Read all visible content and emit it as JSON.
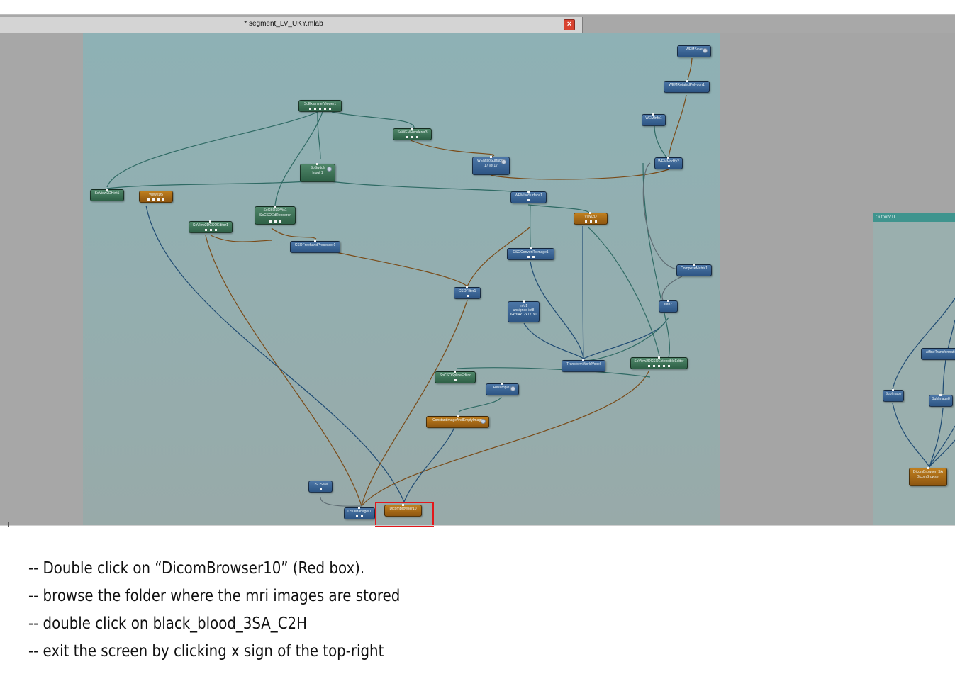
{
  "tab": {
    "title": "* segment_LV_UKY.mlab",
    "close_symbol": "×"
  },
  "network": {
    "nodes": [
      {
        "id": "n1",
        "label": "WEMSave",
        "color": "blue"
      },
      {
        "id": "n2",
        "label": "WEMRotatedPolygon1",
        "color": "blue"
      },
      {
        "id": "n3",
        "label": "WEMInfo1",
        "color": "blue"
      },
      {
        "id": "n4",
        "label": "SoExaminerViewer1",
        "color": "green"
      },
      {
        "id": "n5",
        "label": "SoWEMRenderer3",
        "color": "green"
      },
      {
        "id": "n6",
        "label": "WEMIsoSurface1\n17 @ 17",
        "color": "blue"
      },
      {
        "id": "n7",
        "label": "WEMModify2",
        "color": "blue"
      },
      {
        "id": "n8",
        "label": "SoSwitch\nInput 1",
        "color": "green"
      },
      {
        "id": "n9",
        "label": "SoView2DHint1",
        "color": "green"
      },
      {
        "id": "n10",
        "label": "View2D5",
        "color": "orange"
      },
      {
        "id": "n11",
        "label": "WEMIsoSurface1",
        "color": "blue"
      },
      {
        "id": "n12",
        "label": "SoCSO3DVis1\nSoCSOEdRenderer",
        "color": "green"
      },
      {
        "id": "n13",
        "label": "View2D",
        "color": "orange"
      },
      {
        "id": "n14",
        "label": "SoView2DCSOEditor1",
        "color": "green"
      },
      {
        "id": "n15",
        "label": "CSOFreehandProcessor1",
        "color": "blue"
      },
      {
        "id": "n16",
        "label": "CSOConvertToImage1",
        "color": "blue"
      },
      {
        "id": "n17",
        "label": "ComposeMatrix1",
        "color": "blue"
      },
      {
        "id": "n18",
        "label": "CSOFilter1",
        "color": "blue"
      },
      {
        "id": "n19",
        "label": "Info1\nunsigned int8\n64x64x12x1x1x1",
        "color": "blue"
      },
      {
        "id": "n20",
        "label": "Info7",
        "color": "blue"
      },
      {
        "id": "n21",
        "label": "TransformWorldVoxel",
        "color": "blue"
      },
      {
        "id": "n22",
        "label": "SoView2DCSOExtensibleEditor",
        "color": "green"
      },
      {
        "id": "n23",
        "label": "SoCSOSplineEditor",
        "color": "green"
      },
      {
        "id": "n24",
        "label": "Resample1",
        "color": "blue"
      },
      {
        "id": "n25",
        "label": "ConstantImageAndEmptyImage",
        "color": "orange"
      },
      {
        "id": "n26",
        "label": "CSOSave",
        "color": "blue"
      },
      {
        "id": "n27",
        "label": "CSOManager1",
        "color": "blue"
      },
      {
        "id": "n28",
        "label": "DicomBrowser10",
        "color": "orange"
      }
    ],
    "connection_colors": {
      "blue": "#1f4b73",
      "brown": "#7a4b18",
      "teal": "#2f6a64",
      "gray": "#5f6c73"
    }
  },
  "right_panel": {
    "title": "OutputVTI",
    "nodes": [
      {
        "id": "r1",
        "label": "AffineTransformation",
        "color": "blue"
      },
      {
        "id": "r2",
        "label": "SubImage",
        "color": "blue"
      },
      {
        "id": "r3",
        "label": "SubImage8",
        "color": "blue"
      },
      {
        "id": "r4",
        "label": "DicomBrowser_SA\nDicomBrowser",
        "color": "orange"
      }
    ]
  },
  "colors": {
    "highlight": "#e3171b",
    "canvas": "#8fb0b2",
    "node_blue": "#3b6796",
    "node_green": "#3d7358",
    "node_orange": "#a8681a"
  },
  "instructions": [
    "-- Double click on “DicomBrowser10” (Red box).",
    "-- browse the folder where the mri images are stored",
    "-- double click on black_blood_3SA_C2H",
    "-- exit the screen by clicking x sign of the top-right"
  ]
}
